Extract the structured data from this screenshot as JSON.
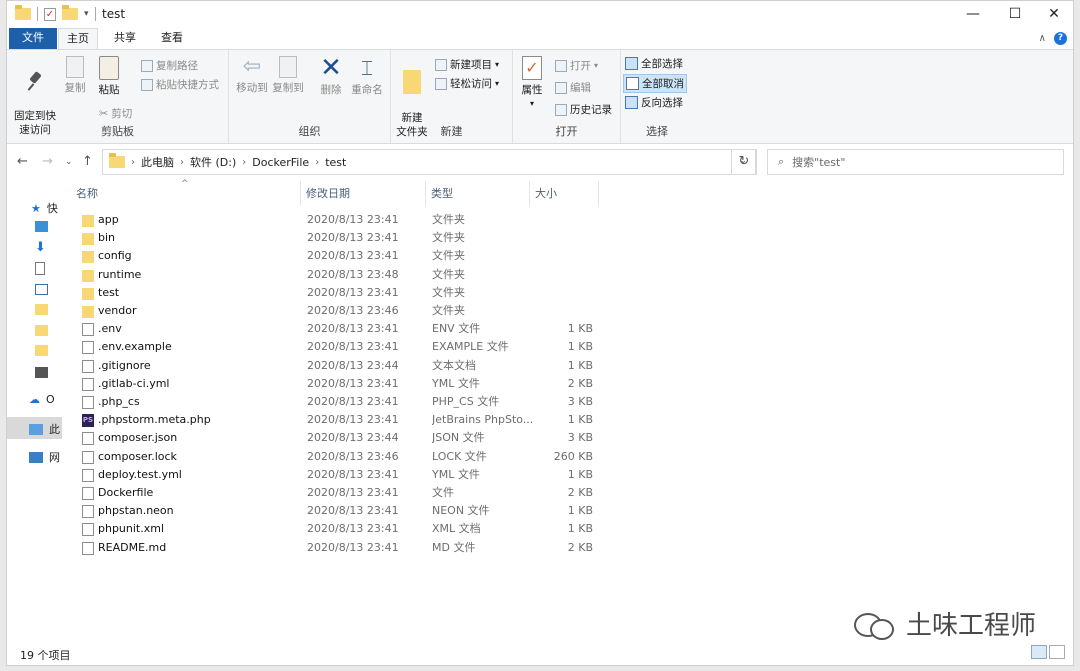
{
  "window": {
    "title": "test",
    "controls": {
      "minimize": "—",
      "maximize": "☐",
      "close": "✕"
    }
  },
  "tabs": [
    "文件",
    "主页",
    "共享",
    "查看"
  ],
  "ribbon": {
    "clipboard": {
      "label": "剪贴板",
      "pin": "固定到快\n速访问",
      "copy": "复制",
      "paste": "粘贴",
      "copy_path": "复制路径",
      "paste_shortcut": "粘贴快捷方式",
      "cut": "剪切"
    },
    "organize": {
      "label": "组织",
      "move_to": "移动到",
      "copy_to": "复制到",
      "delete": "删除",
      "rename": "重命名"
    },
    "new": {
      "label": "新建",
      "new_folder": "新建\n文件夹",
      "new_item": "新建项目",
      "easy_access": "轻松访问"
    },
    "open": {
      "label": "打开",
      "properties": "属性",
      "open": "打开",
      "edit": "编辑",
      "history": "历史记录"
    },
    "select": {
      "label": "选择",
      "select_all": "全部选择",
      "select_none": "全部取消",
      "invert": "反向选择"
    }
  },
  "address": {
    "crumbs": [
      "此电脑",
      "软件 (D:)",
      "DockerFile",
      "test"
    ],
    "search_placeholder": "搜索\"test\""
  },
  "nav": {
    "items": [
      "快",
      "",
      "",
      "",
      "",
      "",
      "",
      "",
      "",
      "O",
      "此",
      "网"
    ]
  },
  "columns": {
    "name": "名称",
    "date": "修改日期",
    "type": "类型",
    "size": "大小"
  },
  "files": [
    {
      "name": "app",
      "date": "2020/8/13 23:41",
      "type": "文件夹",
      "size": "",
      "icon": "folder"
    },
    {
      "name": "bin",
      "date": "2020/8/13 23:41",
      "type": "文件夹",
      "size": "",
      "icon": "folder"
    },
    {
      "name": "config",
      "date": "2020/8/13 23:41",
      "type": "文件夹",
      "size": "",
      "icon": "folder"
    },
    {
      "name": "runtime",
      "date": "2020/8/13 23:48",
      "type": "文件夹",
      "size": "",
      "icon": "folder"
    },
    {
      "name": "test",
      "date": "2020/8/13 23:41",
      "type": "文件夹",
      "size": "",
      "icon": "folder"
    },
    {
      "name": "vendor",
      "date": "2020/8/13 23:46",
      "type": "文件夹",
      "size": "",
      "icon": "folder"
    },
    {
      "name": ".env",
      "date": "2020/8/13 23:41",
      "type": "ENV 文件",
      "size": "1 KB",
      "icon": "file"
    },
    {
      "name": ".env.example",
      "date": "2020/8/13 23:41",
      "type": "EXAMPLE 文件",
      "size": "1 KB",
      "icon": "file"
    },
    {
      "name": ".gitignore",
      "date": "2020/8/13 23:44",
      "type": "文本文档",
      "size": "1 KB",
      "icon": "file"
    },
    {
      "name": ".gitlab-ci.yml",
      "date": "2020/8/13 23:41",
      "type": "YML 文件",
      "size": "2 KB",
      "icon": "file"
    },
    {
      "name": ".php_cs",
      "date": "2020/8/13 23:41",
      "type": "PHP_CS 文件",
      "size": "3 KB",
      "icon": "file"
    },
    {
      "name": ".phpstorm.meta.php",
      "date": "2020/8/13 23:41",
      "type": "JetBrains PhpSto...",
      "size": "1 KB",
      "icon": "ps"
    },
    {
      "name": "composer.json",
      "date": "2020/8/13 23:44",
      "type": "JSON 文件",
      "size": "3 KB",
      "icon": "file"
    },
    {
      "name": "composer.lock",
      "date": "2020/8/13 23:46",
      "type": "LOCK 文件",
      "size": "260 KB",
      "icon": "file"
    },
    {
      "name": "deploy.test.yml",
      "date": "2020/8/13 23:41",
      "type": "YML 文件",
      "size": "1 KB",
      "icon": "file"
    },
    {
      "name": "Dockerfile",
      "date": "2020/8/13 23:41",
      "type": "文件",
      "size": "2 KB",
      "icon": "file"
    },
    {
      "name": "phpstan.neon",
      "date": "2020/8/13 23:41",
      "type": "NEON 文件",
      "size": "1 KB",
      "icon": "file"
    },
    {
      "name": "phpunit.xml",
      "date": "2020/8/13 23:41",
      "type": "XML 文档",
      "size": "1 KB",
      "icon": "file"
    },
    {
      "name": "README.md",
      "date": "2020/8/13 23:41",
      "type": "MD 文件",
      "size": "2 KB",
      "icon": "file"
    }
  ],
  "status": {
    "count": "19 个项目"
  },
  "watermark": {
    "text": "土味工程师"
  }
}
